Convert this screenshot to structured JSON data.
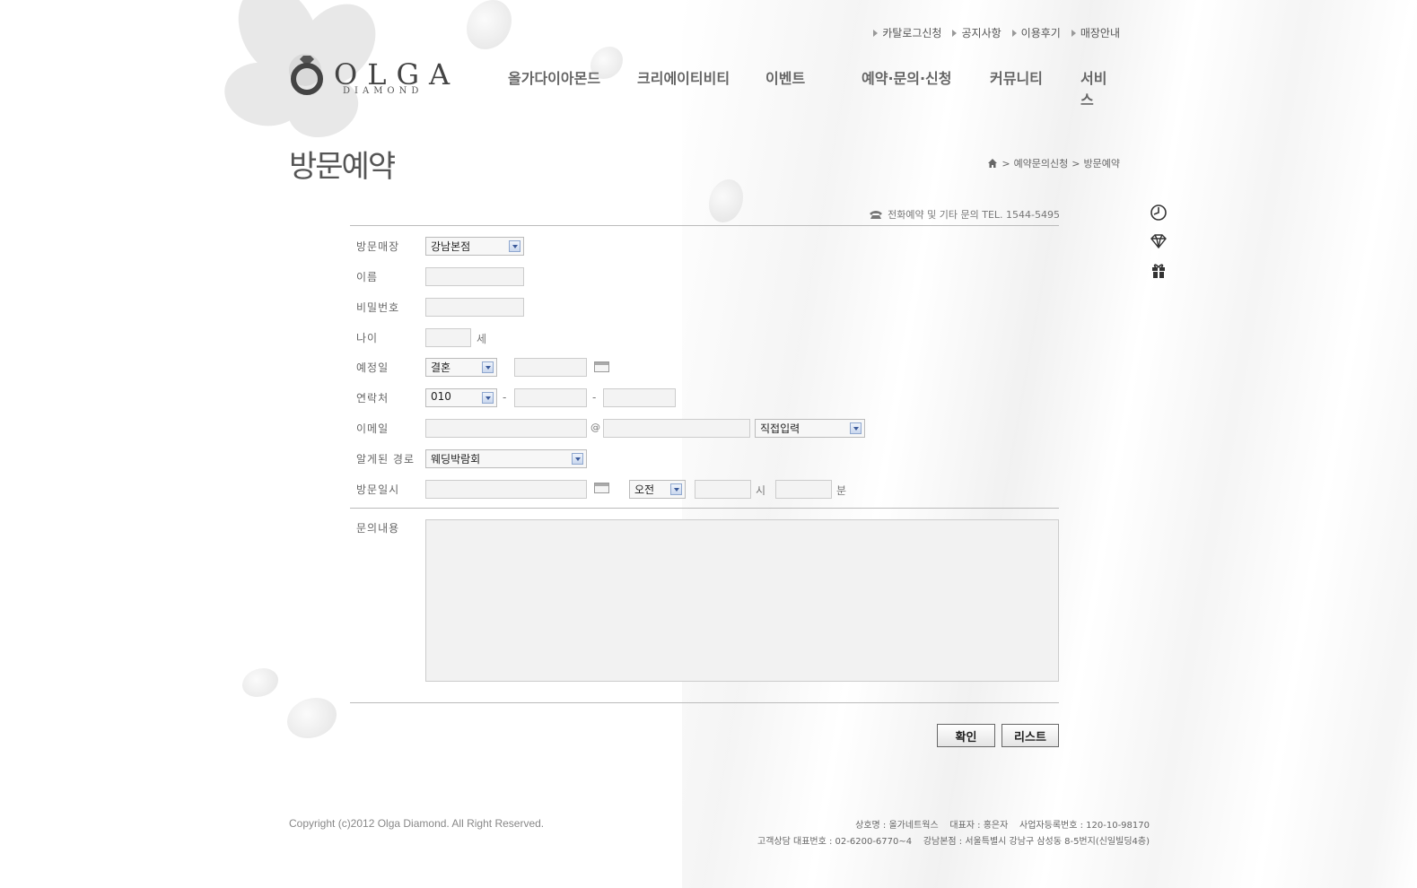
{
  "header": {
    "top_links": [
      "카탈로그신청",
      "공지사항",
      "이용후기",
      "매장안내"
    ],
    "logo": {
      "word": "OLGA",
      "sub": "DIAMOND"
    },
    "nav": [
      "올가다이아몬드",
      "크리에이티비티",
      "이벤트",
      "예약·문의·신청",
      "커뮤니티",
      "서비스"
    ]
  },
  "page": {
    "title": "방문예약",
    "breadcrumb": [
      "예약문의신청",
      "방문예약"
    ]
  },
  "quick_menu": [
    "clock-icon",
    "diamond-icon",
    "gift-icon"
  ],
  "form": {
    "tel_note": "전화예약 및 기타 문의 TEL. 1544-5495",
    "labels": {
      "store": "방문매장",
      "name": "이름",
      "password": "비밀번호",
      "age": "나이",
      "planned_date": "예정일",
      "contact": "연락처",
      "email": "이메일",
      "referral": "알게된 경로",
      "visit_time": "방문일시",
      "inquiry": "문의내용"
    },
    "store_value": "강남본점",
    "age_unit": "세",
    "planned_type_value": "결혼",
    "phone_prefix_value": "010",
    "phone_sep": "-",
    "email_at": "@",
    "email_domain_value": "직접입력",
    "referral_value": "웨딩박람회",
    "ampm_value": "오전",
    "hour_unit": "시",
    "minute_unit": "분"
  },
  "buttons": {
    "confirm": "확인",
    "list": "리스트"
  },
  "footer": {
    "copyright": "Copyright (c)2012 Olga Diamond. All Right Reserved.",
    "biz_line1": "상호명 : 올가네트웍스    대표자 : 홍은자    사업자등록번호 : 120-10-98170",
    "biz_line2": "고객상담 대표번호 : 02-6200-6770~4    강남본점 : 서울특별시 강남구 삼성동 8-5번지(신일빌딩4층)"
  }
}
